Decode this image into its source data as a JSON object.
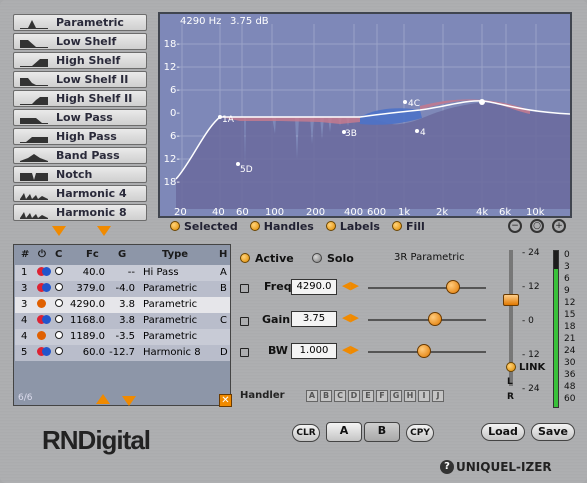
{
  "filter_types": [
    {
      "label": "Parametric",
      "icon": "parametric-icon"
    },
    {
      "label": "Low Shelf",
      "icon": "low-shelf-icon"
    },
    {
      "label": "High Shelf",
      "icon": "high-shelf-icon"
    },
    {
      "label": "Low Shelf II",
      "icon": "low-shelf-ii-icon"
    },
    {
      "label": "High Shelf II",
      "icon": "high-shelf-ii-icon"
    },
    {
      "label": "Low Pass",
      "icon": "low-pass-icon"
    },
    {
      "label": "High Pass",
      "icon": "high-pass-icon"
    },
    {
      "label": "Band Pass",
      "icon": "band-pass-icon"
    },
    {
      "label": "Notch",
      "icon": "notch-icon"
    },
    {
      "label": "Harmonic 4",
      "icon": "harmonic-icon"
    },
    {
      "label": "Harmonic 8",
      "icon": "harmonic-icon"
    }
  ],
  "graph": {
    "readout_freq": "4290 Hz",
    "readout_gain": "3.75 dB",
    "y_labels": [
      "18-",
      "12-",
      "6-",
      "0-",
      "6-",
      "12-",
      "18-"
    ],
    "x_labels": [
      "20",
      "40",
      "60",
      "100",
      "200",
      "400",
      "600",
      "1k",
      "2k",
      "4k",
      "6k",
      "10k"
    ],
    "handle_labels": [
      "1A",
      "5D",
      "3B",
      "4C",
      "4"
    ]
  },
  "toggles": {
    "selected": "Selected",
    "handles": "Handles",
    "labels": "Labels",
    "fill": "Fill"
  },
  "table": {
    "headers": [
      "#",
      "⏻",
      "C",
      "Fc",
      "G",
      "Type",
      "H"
    ],
    "rows": [
      {
        "num": "1",
        "fc": "40.0",
        "g": "--",
        "type": "Hi Pass",
        "h": "A"
      },
      {
        "num": "3",
        "fc": "379.0",
        "g": "-4.0",
        "type": "Parametric",
        "h": "B"
      },
      {
        "num": "3",
        "fc": "4290.0",
        "g": "3.8",
        "type": "Parametric",
        "h": ""
      },
      {
        "num": "4",
        "fc": "1168.0",
        "g": "3.8",
        "type": "Parametric",
        "h": "C"
      },
      {
        "num": "4",
        "fc": "1189.0",
        "g": "-3.5",
        "type": "Parametric",
        "h": ""
      },
      {
        "num": "5",
        "fc": "60.0",
        "g": "-12.7",
        "type": "Harmonic 8",
        "h": "D"
      }
    ],
    "count": "6/6"
  },
  "params": {
    "active": "Active",
    "solo": "Solo",
    "filter_name": "3R Parametric",
    "freq_label": "Freq",
    "freq_value": "4290.0",
    "gain_label": "Gain",
    "gain_value": "3.75",
    "bw_label": "BW",
    "bw_value": "1.000"
  },
  "handler": {
    "label": "Handler",
    "slots": [
      "A",
      "B",
      "C",
      "D",
      "E",
      "F",
      "G",
      "H",
      "I",
      "J"
    ]
  },
  "meter": {
    "left_scale": [
      "24",
      "12",
      "0",
      "12",
      "24"
    ],
    "right_scale": [
      "0",
      "3",
      "6",
      "9",
      "12",
      "15",
      "18",
      "21",
      "24",
      "30",
      "36",
      "48",
      "60"
    ],
    "link_label": "LINK",
    "l_label": "L",
    "r_label": "R",
    "left_ticks": [
      "- 24",
      "- 12",
      "- 0",
      "- 12",
      "- 24"
    ]
  },
  "bottom": {
    "clr": "CLR",
    "a": "A",
    "b": "B",
    "cpy": "CPY",
    "load": "Load",
    "save": "Save",
    "brand": "RNDigital",
    "product": "UNIQUEL-IZER",
    "help": "?"
  },
  "colors": {
    "accent": "#f08a00",
    "graph_bg": "#7e88b8",
    "meter_green": "#39c13a"
  }
}
